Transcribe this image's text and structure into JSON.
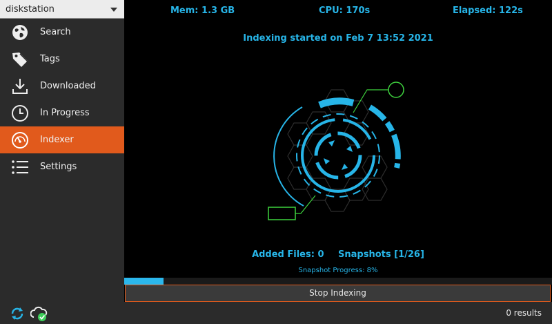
{
  "sidebar": {
    "server": "diskstation",
    "items": [
      {
        "label": "Search",
        "icon": "globe-icon"
      },
      {
        "label": "Tags",
        "icon": "tag-icon"
      },
      {
        "label": "Downloaded",
        "icon": "download-icon"
      },
      {
        "label": "In Progress",
        "icon": "clock-icon"
      },
      {
        "label": "Indexer",
        "icon": "speedometer-icon",
        "active": true
      },
      {
        "label": "Settings",
        "icon": "list-icon"
      }
    ]
  },
  "stats": {
    "mem": "Mem: 1.3 GB",
    "cpu": "CPU: 170s",
    "elapsed": "Elapsed: 122s"
  },
  "indexing_started": "Indexing started on Feb 7 13:52 2021",
  "counts": {
    "added_files": "Added Files: 0",
    "snapshots": "Snapshots [1/26]"
  },
  "snapshot_progress": {
    "label": "Snapshot Progress: 8%",
    "fraction": 0.092
  },
  "stop_button": "Stop Indexing",
  "statusbar": {
    "results": "0 results"
  },
  "colors": {
    "accent": "#e15a1c",
    "cyan": "#27b5e8",
    "green": "#3ed23e"
  }
}
